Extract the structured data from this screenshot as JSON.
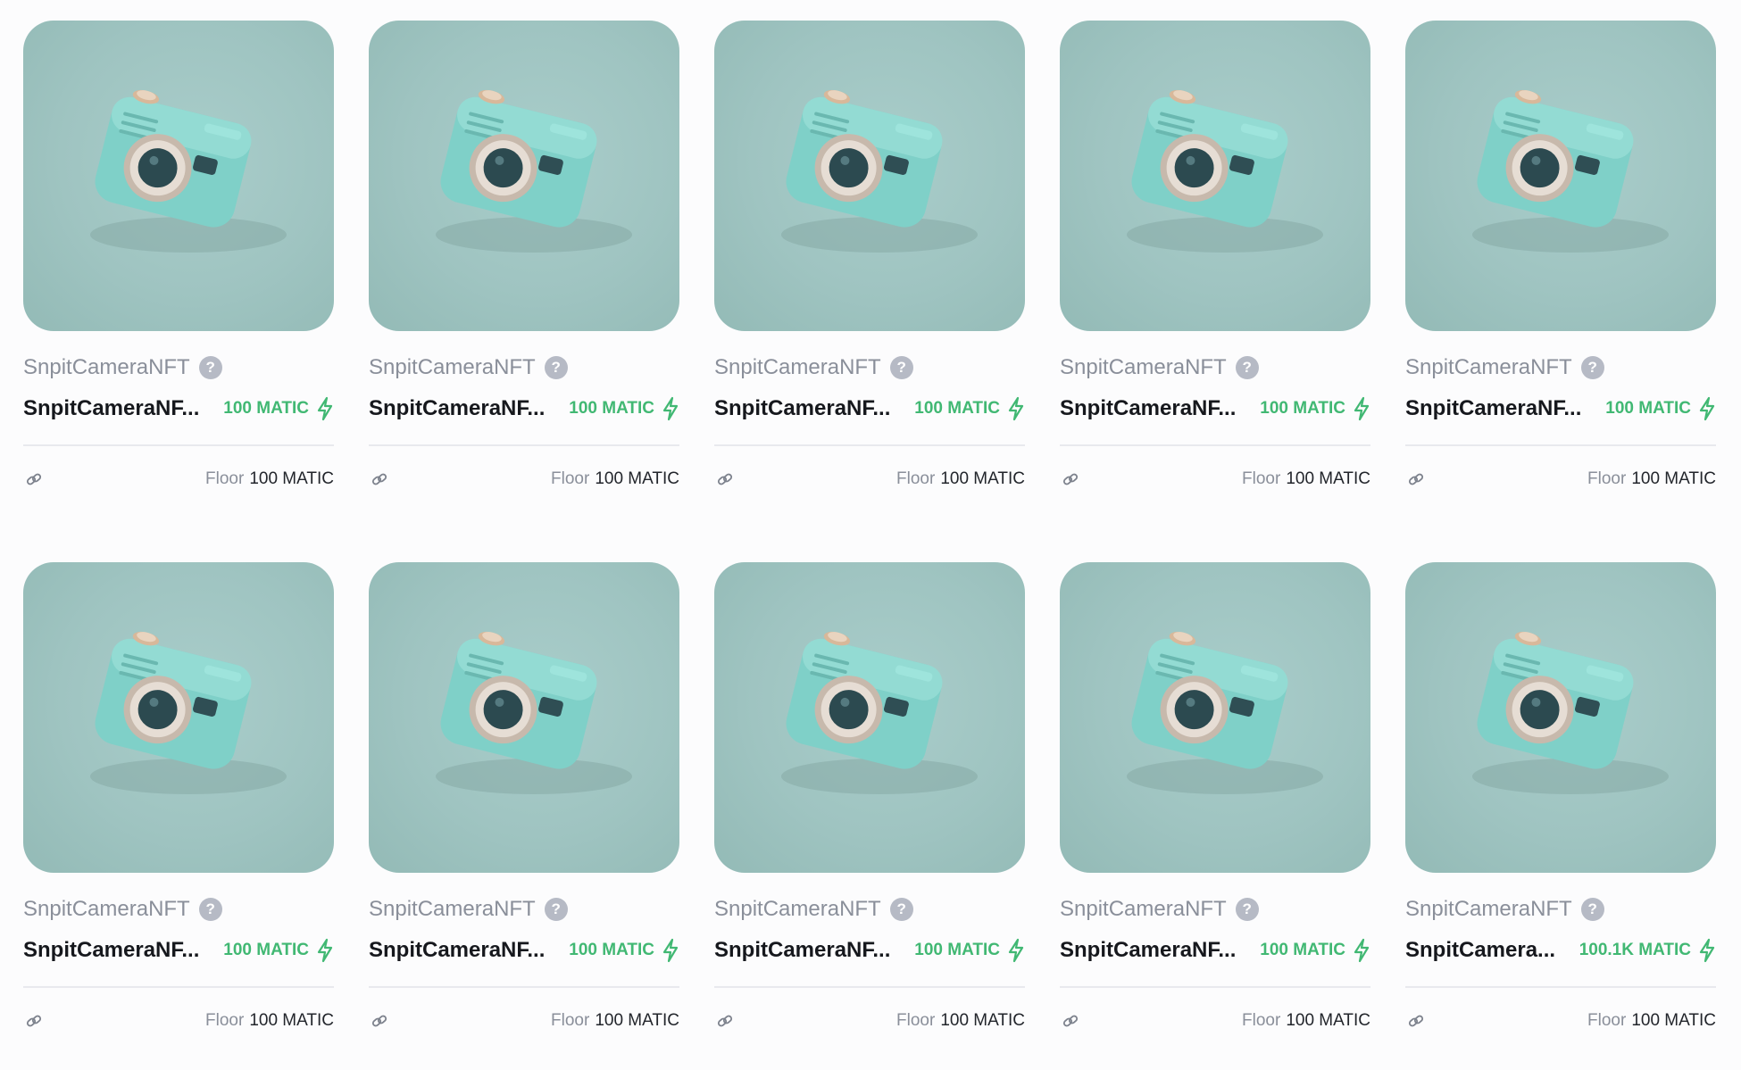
{
  "colors": {
    "price_green": "#41b873",
    "image_bg": "#9fc4c1",
    "camera_body": "#7fd0c8",
    "muted_text": "#8a8f9a"
  },
  "icons": {
    "help": "question-mark-circle",
    "price": "lightning-bolt",
    "footer": "chain-link"
  },
  "cards": [
    {
      "collection": "SnpitCameraNFT",
      "help": "?",
      "name": "SnpitCameraNF...",
      "price": "100 MATIC",
      "floor_label": "Floor",
      "floor_value": "100 MATIC"
    },
    {
      "collection": "SnpitCameraNFT",
      "help": "?",
      "name": "SnpitCameraNF...",
      "price": "100 MATIC",
      "floor_label": "Floor",
      "floor_value": "100 MATIC"
    },
    {
      "collection": "SnpitCameraNFT",
      "help": "?",
      "name": "SnpitCameraNF...",
      "price": "100 MATIC",
      "floor_label": "Floor",
      "floor_value": "100 MATIC"
    },
    {
      "collection": "SnpitCameraNFT",
      "help": "?",
      "name": "SnpitCameraNF...",
      "price": "100 MATIC",
      "floor_label": "Floor",
      "floor_value": "100 MATIC"
    },
    {
      "collection": "SnpitCameraNFT",
      "help": "?",
      "name": "SnpitCameraNF...",
      "price": "100 MATIC",
      "floor_label": "Floor",
      "floor_value": "100 MATIC"
    },
    {
      "collection": "SnpitCameraNFT",
      "help": "?",
      "name": "SnpitCameraNF...",
      "price": "100 MATIC",
      "floor_label": "Floor",
      "floor_value": "100 MATIC"
    },
    {
      "collection": "SnpitCameraNFT",
      "help": "?",
      "name": "SnpitCameraNF...",
      "price": "100 MATIC",
      "floor_label": "Floor",
      "floor_value": "100 MATIC"
    },
    {
      "collection": "SnpitCameraNFT",
      "help": "?",
      "name": "SnpitCameraNF...",
      "price": "100 MATIC",
      "floor_label": "Floor",
      "floor_value": "100 MATIC"
    },
    {
      "collection": "SnpitCameraNFT",
      "help": "?",
      "name": "SnpitCameraNF...",
      "price": "100 MATIC",
      "floor_label": "Floor",
      "floor_value": "100 MATIC"
    },
    {
      "collection": "SnpitCameraNFT",
      "help": "?",
      "name": "SnpitCamera...",
      "price": "100.1K MATIC",
      "floor_label": "Floor",
      "floor_value": "100 MATIC"
    }
  ]
}
